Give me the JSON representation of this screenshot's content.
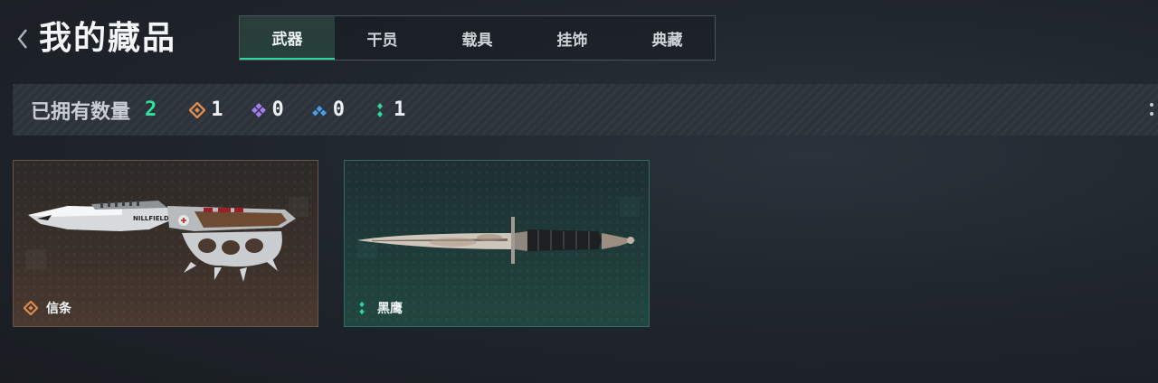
{
  "header": {
    "title": "我的藏品",
    "tabs": [
      {
        "label": "武器",
        "active": true
      },
      {
        "label": "干员",
        "active": false
      },
      {
        "label": "载具",
        "active": false
      },
      {
        "label": "挂饰",
        "active": false
      },
      {
        "label": "典藏",
        "active": false
      }
    ]
  },
  "stats": {
    "label": "已拥有数量",
    "total": "2",
    "rarities": [
      {
        "icon": "orange-diamond-icon",
        "count": "1",
        "color": "#e08a4c"
      },
      {
        "icon": "purple-diamond-icon",
        "count": "0",
        "color": "#a77cf0"
      },
      {
        "icon": "blue-diamond-icon",
        "count": "0",
        "color": "#4a9ee8"
      },
      {
        "icon": "teal-diamond-icon",
        "count": "1",
        "color": "#2fd59a"
      }
    ]
  },
  "items": [
    {
      "name": "信条",
      "rarity_icon": "orange-diamond-icon",
      "rarity_color": "#e08a4c",
      "image": "knuckle-knife"
    },
    {
      "name": "黑鹰",
      "rarity_icon": "teal-diamond-icon",
      "rarity_color": "#2fd59a",
      "image": "combat-knife"
    }
  ],
  "colors": {
    "accent": "#2fe39c",
    "background": "#20262d"
  }
}
